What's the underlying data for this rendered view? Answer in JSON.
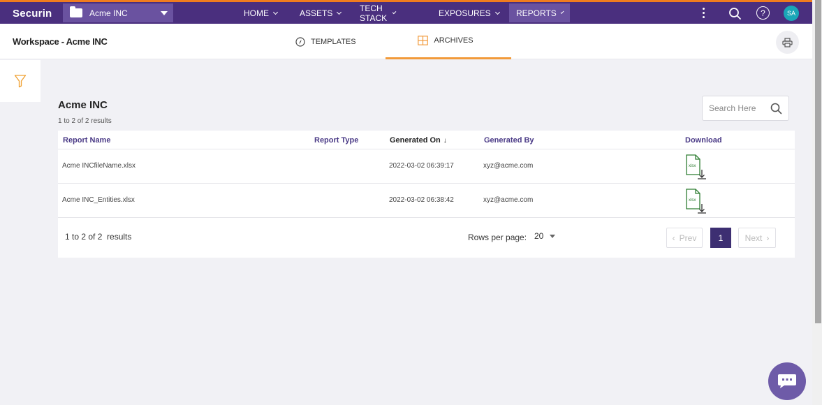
{
  "topbar": {
    "brand": "Securin",
    "workspace_selector": "Acme INC",
    "nav": [
      {
        "label": "HOME"
      },
      {
        "label": "ASSETS"
      },
      {
        "label": "TECH STACK"
      },
      {
        "label": "EXPOSURES"
      },
      {
        "label": "REPORTS"
      }
    ],
    "avatar_initials": "SA",
    "help_label": "?"
  },
  "subheader": {
    "title": "Workspace - Acme INC",
    "tabs": [
      {
        "label": "TEMPLATES",
        "icon": "compass-icon"
      },
      {
        "label": "ARCHIVES",
        "icon": "grid-icon"
      }
    ]
  },
  "content": {
    "title": "Acme INC",
    "count_text": "1 to 2 of 2 results",
    "search_placeholder": "Search Here"
  },
  "table": {
    "columns": [
      "Report Name",
      "Report Type",
      "Generated On",
      "Generated By",
      "Download"
    ],
    "sort_arrow": "↓",
    "rows": [
      {
        "name": "Acme INCfileName.xlsx",
        "type": "",
        "generated_on": "2022-03-02 06:39:17",
        "generated_by": "xyz@acme.com"
      },
      {
        "name": "Acme INC_Entities.xlsx",
        "type": "",
        "generated_on": "2022-03-02 06:38:42",
        "generated_by": "xyz@acme.com"
      }
    ],
    "file_icon_label": "xlsx"
  },
  "pagination": {
    "results_text": "1 to 2 of 2  results",
    "rows_per_page_label": "Rows per page:",
    "rows_per_page_value": "20",
    "prev_label": "Prev",
    "next_label": "Next",
    "current_page": "1"
  },
  "colors": {
    "topbar": "#4a2f7e",
    "accent_orange": "#f07c1e",
    "link_purple": "#4a3a86",
    "page_active": "#3d2f72",
    "xlsx_green": "#2e7d32",
    "chat": "#6e5ba8"
  }
}
